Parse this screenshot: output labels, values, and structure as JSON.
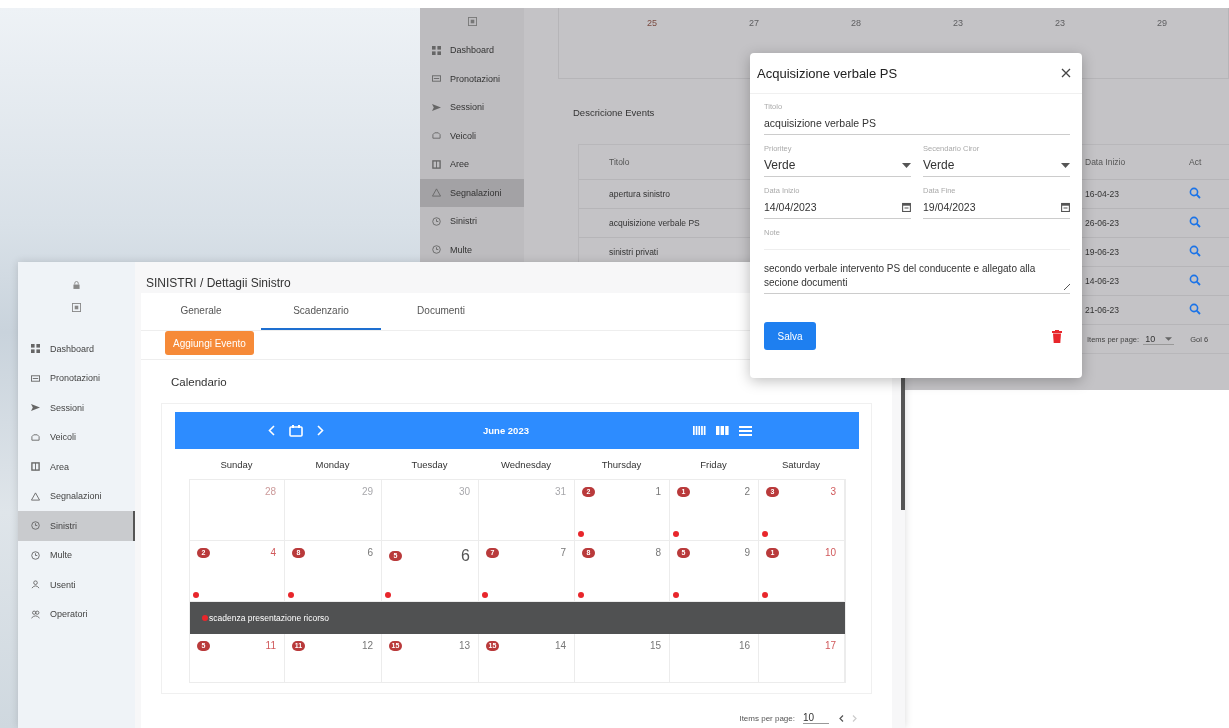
{
  "back_window": {
    "sidebar": {
      "items": [
        {
          "label": "Dashboard",
          "selected": false
        },
        {
          "label": "Pronotazioni",
          "selected": false
        },
        {
          "label": "Sessioni",
          "selected": false
        },
        {
          "label": "Veicoli",
          "selected": false
        },
        {
          "label": "Aree",
          "selected": false
        },
        {
          "label": "Segnalazioni",
          "selected": true
        },
        {
          "label": "Sinistri",
          "selected": false
        },
        {
          "label": "Multe",
          "selected": false
        }
      ]
    },
    "calendar_strip": [
      "25",
      "27",
      "28",
      "23",
      "23",
      "29"
    ],
    "events_panel": {
      "title": "Descricione Events",
      "columns": [
        "Titolo",
        "Data Inizio",
        "Act"
      ],
      "rows": [
        {
          "titolo": "apertura sinistro",
          "data_inizio": "16-04-23"
        },
        {
          "titolo": "acquisizione verbale PS",
          "data_inizio": "26-06-23"
        },
        {
          "titolo": "sinistri privati",
          "data_inizio": "19-06-23"
        },
        {
          "data_inizio": "14-06-23"
        },
        {
          "data_inizio": "21-06-23"
        }
      ],
      "pagination": {
        "label": "Items per page:",
        "value": "10",
        "range": "Gol 6"
      }
    }
  },
  "front_window": {
    "sidebar": {
      "items": [
        {
          "label": "Dashboard",
          "selected": false
        },
        {
          "label": "Pronotazioni",
          "selected": false
        },
        {
          "label": "Sessioni",
          "selected": false
        },
        {
          "label": "Veicoli",
          "selected": false
        },
        {
          "label": "Area",
          "selected": false
        },
        {
          "label": "Segnalazioni",
          "selected": false
        },
        {
          "label": "Sinistri",
          "selected": true
        },
        {
          "label": "Multe",
          "selected": false
        },
        {
          "label": "Usenti",
          "selected": false
        },
        {
          "label": "Operatori",
          "selected": false
        }
      ]
    },
    "breadcrumb": {
      "section": "SINISTRI",
      "separator": "/",
      "page": "Dettagii Sinistro"
    },
    "tabs": [
      {
        "label": "Generale",
        "selected": false
      },
      {
        "label": "Scadenzario",
        "selected": true
      },
      {
        "label": "Documenti",
        "selected": false
      }
    ],
    "add_button": "Aggiungi Evento",
    "calendar_title": "Calendario",
    "calendar": {
      "month": "June 2023",
      "weekdays": [
        "Sunday",
        "Monday",
        "Tuesday",
        "Wednesday",
        "Thursday",
        "Friday",
        "Saturday"
      ],
      "weeks": [
        {
          "days": [
            {
              "day": "28",
              "other_month": true,
              "dot": false
            },
            {
              "day": "29",
              "other_month": true,
              "dot": false
            },
            {
              "day": "30",
              "other_month": true,
              "dot": false
            },
            {
              "day": "31",
              "other_month": true,
              "dot": false
            },
            {
              "day": "1",
              "badge": "2",
              "other_month": false,
              "dot": true
            },
            {
              "day": "2",
              "badge": "1",
              "other_month": false,
              "dot": true
            },
            {
              "day": "3",
              "badge": "3",
              "other_month": false,
              "dot": true
            }
          ]
        },
        {
          "days": [
            {
              "day": "4",
              "badge": "2",
              "other_month": false,
              "dot": true
            },
            {
              "day": "6",
              "badge": "8",
              "other_month": false,
              "dot": true
            },
            {
              "day": "6",
              "badge": "5",
              "other_month": false,
              "dot": true,
              "today": true
            },
            {
              "day": "7",
              "badge": "7",
              "other_month": false,
              "dot": true
            },
            {
              "day": "8",
              "badge": "8",
              "other_month": false,
              "dot": true
            },
            {
              "day": "9",
              "badge": "5",
              "other_month": false,
              "dot": true
            },
            {
              "day": "10",
              "badge": "1",
              "other_month": false,
              "dot": true
            }
          ],
          "events": [
            "scadenza presentazione ricorso"
          ]
        },
        {
          "days": [
            {
              "day": "11",
              "badge": "5",
              "other_month": false,
              "dot": false
            },
            {
              "day": "12",
              "badge": "11",
              "other_month": false,
              "dot": false
            },
            {
              "day": "13",
              "badge": "15",
              "other_month": false,
              "dot": false
            },
            {
              "day": "14",
              "badge": "15",
              "other_month": false,
              "dot": false
            },
            {
              "day": "15",
              "other_month": false,
              "dot": false
            },
            {
              "day": "16",
              "other_month": false,
              "dot": false
            },
            {
              "day": "17",
              "other_month": false,
              "dot": false
            }
          ]
        }
      ]
    },
    "pagination": {
      "label": "Items per page:",
      "value": "10"
    }
  },
  "dialog": {
    "title": "Acquisizione verbale PS",
    "fields": [
      {
        "kind": "text",
        "label": "Titolo",
        "value": "acquisizione verbale PS"
      },
      {
        "kind": "select",
        "label": "Prioritey",
        "value": "Verde"
      },
      {
        "kind": "select",
        "label": "Secendario Ciror",
        "value": "Verde"
      },
      {
        "kind": "date",
        "label": "Data Inizio",
        "value": "14/04/2023"
      },
      {
        "kind": "date",
        "label": "Data Fine",
        "value": "19/04/2023"
      },
      {
        "kind": "textarea",
        "label": "Note",
        "value": "secondo verbale intervento PS del conducente e allegato alla secione documenti"
      }
    ],
    "save_button": "Salva"
  }
}
